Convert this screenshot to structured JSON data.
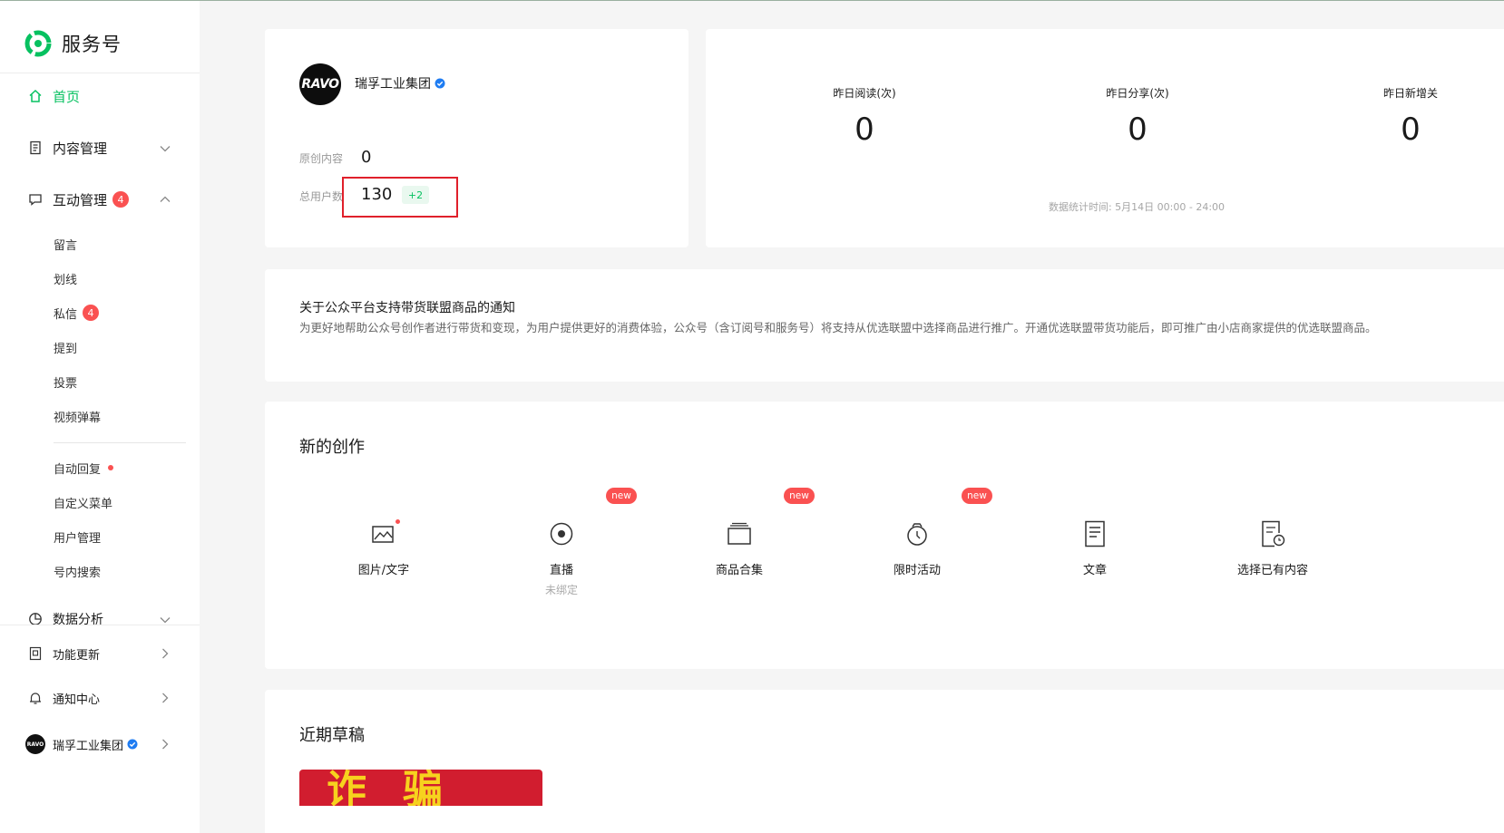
{
  "app": {
    "title": "服务号"
  },
  "sidebar": {
    "home": "首页",
    "content_mgmt": "内容管理",
    "interaction_mgmt": "互动管理",
    "interaction_badge": "4",
    "sub_items": {
      "comments": "留言",
      "underline": "划线",
      "messages": "私信",
      "messages_badge": "4",
      "mentions": "提到",
      "votes": "投票",
      "danmaku": "视频弹幕",
      "auto_reply": "自动回复",
      "custom_menu": "自定义菜单",
      "user_mgmt": "用户管理",
      "search": "号内搜索"
    },
    "data_analysis": "数据分析",
    "feature_updates": "功能更新",
    "notifications": "通知中心",
    "account_name": "瑞孚工业集团",
    "account_avatar_text": "RAVO"
  },
  "account": {
    "avatar_text": "RAVO",
    "name": "瑞孚工业集团",
    "original_label": "原创内容",
    "original_value": "0",
    "users_label": "总用户数",
    "users_value": "130",
    "users_delta": "+2"
  },
  "stats": {
    "items": [
      {
        "label": "昨日阅读(次)",
        "value": "0"
      },
      {
        "label": "昨日分享(次)",
        "value": "0"
      },
      {
        "label": "昨日新增关",
        "value": "0"
      }
    ],
    "time_note": "数据统计时间: 5月14日 00:00 - 24:00"
  },
  "notice": {
    "title": "关于公众平台支持带货联盟商品的通知",
    "body": "为更好地帮助公众号创作者进行带货和变现，为用户提供更好的消费体验，公众号（含订阅号和服务号）将支持从优选联盟中选择商品进行推广。开通优选联盟带货功能后，即可推广由小店商家提供的优选联盟商品。"
  },
  "create": {
    "title": "新的创作",
    "new_label": "new",
    "items": [
      {
        "label": "图片/文字",
        "icon": "image-text-icon"
      },
      {
        "label": "直播",
        "sub": "未绑定",
        "icon": "live-icon"
      },
      {
        "label": "商品合集",
        "icon": "product-collection-icon"
      },
      {
        "label": "限时活动",
        "icon": "limited-activity-icon"
      },
      {
        "label": "文章",
        "icon": "article-icon"
      },
      {
        "label": "选择已有内容",
        "icon": "existing-content-icon"
      }
    ]
  },
  "drafts": {
    "title": "近期草稿",
    "thumb_text": "诈骗"
  },
  "colors": {
    "accent": "#07c160",
    "badge": "#fa5151",
    "highlight": "#e0202b"
  }
}
